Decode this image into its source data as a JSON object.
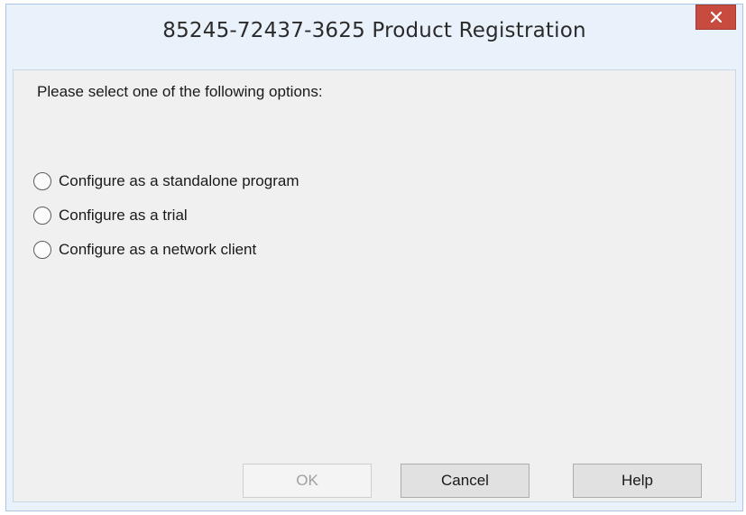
{
  "window": {
    "title": "85245-72437-3625 Product Registration",
    "close_icon": "close-icon",
    "accent_color": "#c74b3f"
  },
  "dialog": {
    "prompt": "Please select one of the following options:",
    "options": [
      {
        "label": "Configure as a standalone program",
        "selected": false
      },
      {
        "label": "Configure as a trial",
        "selected": false
      },
      {
        "label": "Configure as a network client",
        "selected": false
      }
    ]
  },
  "buttons": {
    "ok_label": "OK",
    "ok_enabled": false,
    "cancel_label": "Cancel",
    "help_label": "Help"
  }
}
